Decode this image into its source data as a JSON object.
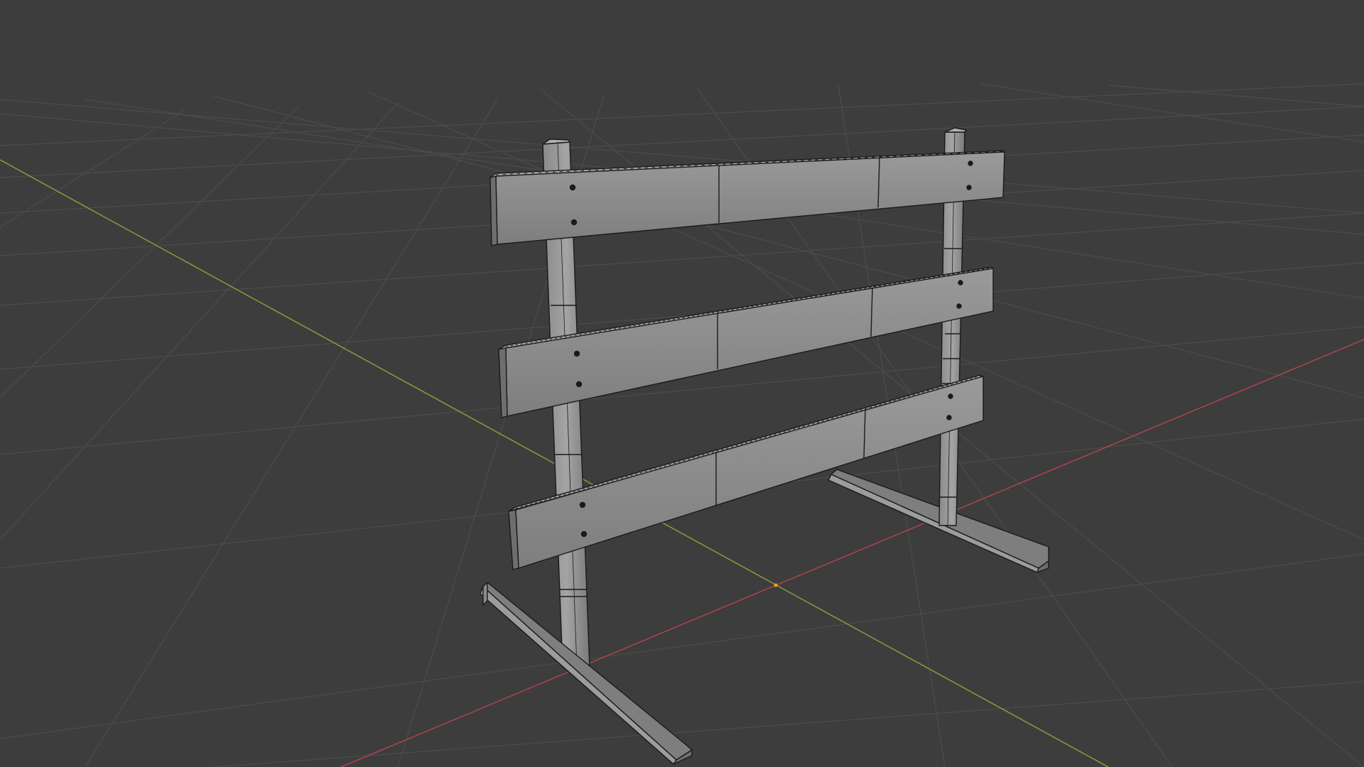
{
  "viewport": {
    "mode": "3D Viewport",
    "background_color": "#3d3d3d",
    "grid_color": "#4f4f4f",
    "x_axis_color": "#c04850",
    "y_axis_color": "#8aa83a",
    "origin_color": "#f0a020"
  },
  "object": {
    "name": "wooden-barrier",
    "face_color": "#8e8e8e",
    "edge_color": "#1a1a1a"
  }
}
